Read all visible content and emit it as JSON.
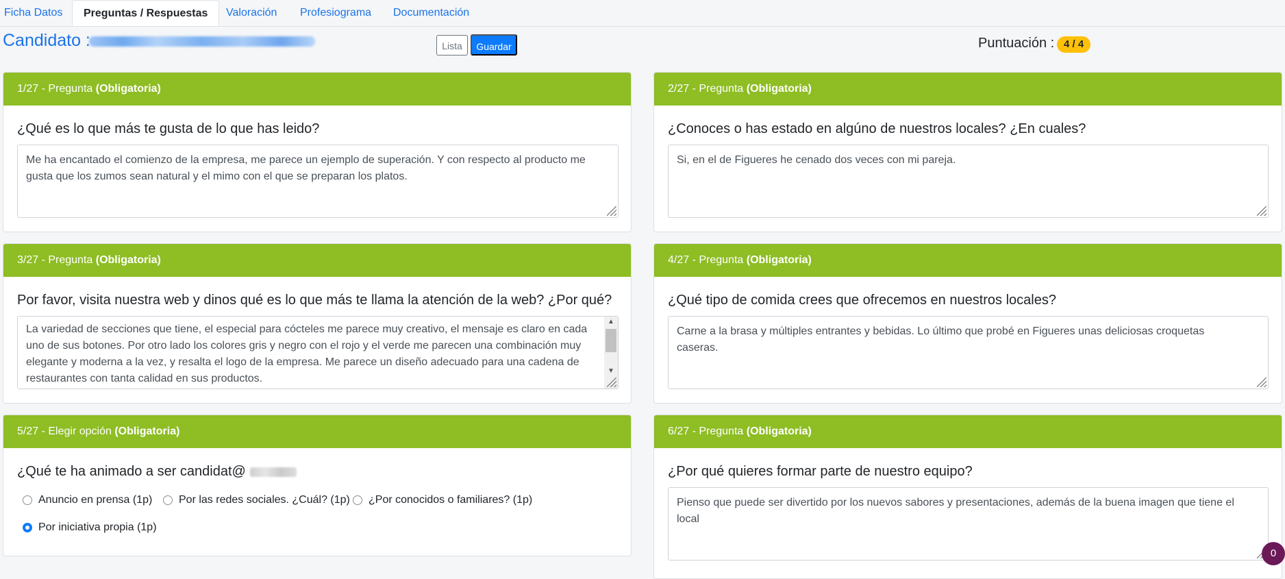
{
  "tabs": [
    {
      "label": "Ficha Datos"
    },
    {
      "label": "Preguntas / Respuestas"
    },
    {
      "label": "Valoración"
    },
    {
      "label": "Profesiograma"
    },
    {
      "label": "Documentación"
    }
  ],
  "candidate": {
    "label": "Candidato :"
  },
  "buttons": {
    "lista": "Lista",
    "guardar": "Guardar"
  },
  "score": {
    "label": "Puntuación :",
    "value": "4 / 4"
  },
  "questions": [
    {
      "header_prefix": "1/27 - Pregunta",
      "header_required": "(Obligatoria)",
      "question": "¿Qué es lo que más te gusta de lo que has leido?",
      "answer": "Me ha encantado el comienzo de la empresa, me parece un ejemplo de superación. Y con respecto al producto me gusta que los zumos sean natural y el mimo con el que se preparan los platos."
    },
    {
      "header_prefix": "2/27 - Pregunta",
      "header_required": "(Obligatoria)",
      "question": "¿Conoces o has estado en algúno de nuestros locales? ¿En cuales?",
      "answer": "Si, en el de Figueres he cenado dos veces con mi pareja."
    },
    {
      "header_prefix": "3/27 - Pregunta",
      "header_required": "(Obligatoria)",
      "question": "Por favor, visita nuestra web y dinos qué es lo que más te llama la atención de la web? ¿Por qué?",
      "answer": "La variedad de secciones que tiene, el especial para cócteles me parece muy creativo, el mensaje es claro en cada uno de sus botones. Por otro lado los colores gris y negro con el rojo y el verde me parecen una combinación muy elegante y moderna a la vez, y resalta el logo de la empresa. Me parece un diseño adecuado para una cadena de restaurantes con tanta calidad en sus productos."
    },
    {
      "header_prefix": "4/27 - Pregunta",
      "header_required": "(Obligatoria)",
      "question": "¿Qué tipo de comida crees que ofrecemos en nuestros locales?",
      "answer": "Carne a la brasa y múltiples entrantes y bebidas. Lo último que probé en Figueres unas deliciosas croquetas caseras."
    },
    {
      "header_prefix": "5/27 - Elegir opción",
      "header_required": "(Obligatoria)",
      "question": "¿Qué te ha animado a ser candidat@",
      "options": [
        {
          "label": "Anuncio en prensa (1p)",
          "checked": false
        },
        {
          "label": "Por las redes sociales. ¿Cuál? (1p)",
          "checked": false
        },
        {
          "label": "¿Por conocidos o familiares? (1p)",
          "checked": false
        },
        {
          "label": "Por iniciativa propia (1p)",
          "checked": true
        }
      ]
    },
    {
      "header_prefix": "6/27 - Pregunta",
      "header_required": "(Obligatoria)",
      "question": "¿Por qué quieres formar parte de nuestro equipo?",
      "answer": "Pienso que puede ser divertido por los nuevos sabores y presentaciones, además de la buena imagen que tiene el local"
    }
  ],
  "chat": {
    "count": "0"
  },
  "colors": {
    "header_green": "#8ebd24",
    "link_blue": "#1a73e8",
    "primary": "#0d7bfd",
    "badge": "#ffc107"
  }
}
